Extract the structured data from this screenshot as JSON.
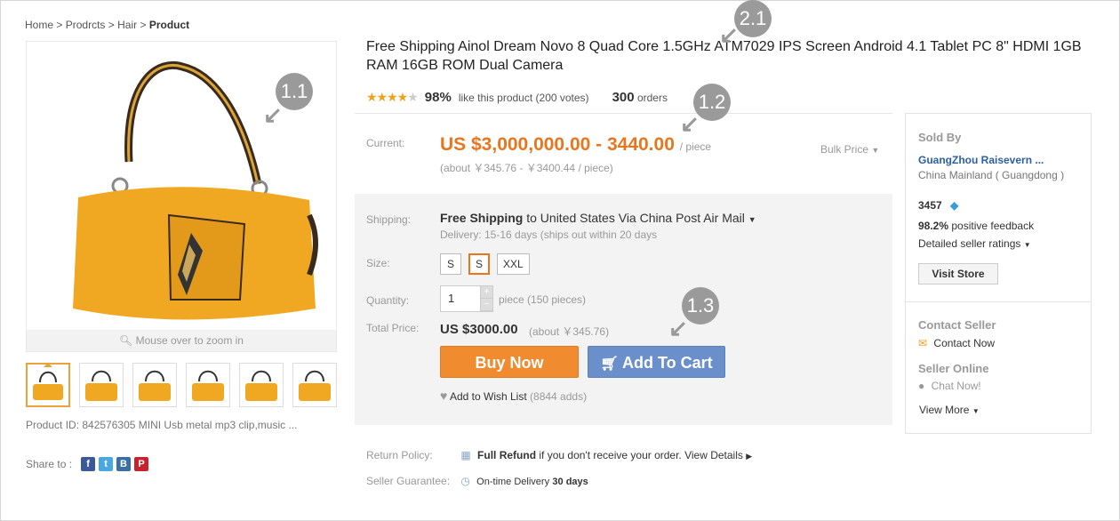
{
  "breadcrumb": {
    "home": "Home",
    "sep": ">",
    "c1": "Prodrcts",
    "c2": "Hair",
    "current": "Product"
  },
  "gallery": {
    "zoom_hint": "Mouse over to zoom in"
  },
  "product": {
    "id_label": "Product ID: 842576305 MINI Usb metal mp3 clip,music ...",
    "title": "Free Shipping Ainol Dream Novo 8 Quad Core 1.5GHz ATM7029 IPS Screen Android 4.1 Tablet PC 8\" HDMI 1GB RAM 16GB ROM Dual Camera",
    "rating_pct": "98%",
    "rating_text": "like this product (200 votes)",
    "orders_count": "300",
    "orders_label": "orders",
    "stars": 3.5
  },
  "share": {
    "label": "Share to :"
  },
  "price": {
    "label": "Current:",
    "value": "US $3,000,000.00 - 3440.00",
    "unit": "/ piece",
    "about": "(about ￥345.76 - ￥3400.44 / piece)",
    "bulk": "Bulk Price"
  },
  "shipping": {
    "label": "Shipping:",
    "free": "Free Shipping",
    "rest": "to United States Via China Post Air Mail",
    "delivery": "Delivery: 15-16 days (ships out within 20 days"
  },
  "size": {
    "label": "Size:",
    "options": [
      "S",
      "S",
      "XXL"
    ]
  },
  "quantity": {
    "label": "Quantity:",
    "value": "1",
    "pieces": "piece  (150 pieces)"
  },
  "total": {
    "label": "Total Price:",
    "value": "US $3000.00",
    "about": "(about  ￥345.76)"
  },
  "actions": {
    "buy": "Buy Now",
    "cart": "Add To Cart",
    "wish": "Add to Wish List",
    "wish_count": "(8844 adds)"
  },
  "policy": {
    "return_label": "Return Policy:",
    "return_bold": "Full Refund",
    "return_text": "if you don't receive your order. View Details",
    "guar_label": "Seller Guarantee:",
    "guar_text": "On-time Delivery",
    "guar_bold": "30 days"
  },
  "seller": {
    "sold_by": "Sold By",
    "name": "GuangZhou Raisevern ...",
    "location": "China Mainland ( Guangdong )",
    "score": "3457",
    "feedback_pct": "98.2%",
    "feedback_text": "positive feedback",
    "detailed": "Detailed seller ratings",
    "visit": "Visit Store",
    "contact_title": "Contact Seller",
    "contact_now": "Contact Now",
    "online_title": "Seller Online",
    "chat": "Chat Now!",
    "view_more": "View More"
  },
  "callouts": {
    "c11": "1.1",
    "c12": "1.2",
    "c13": "1.3",
    "c21": "2.1"
  },
  "colors": {
    "accent": "#e8761e",
    "cart": "#6a8fcb",
    "star": "#f0a21b",
    "seller_link": "#2a5fa0"
  }
}
